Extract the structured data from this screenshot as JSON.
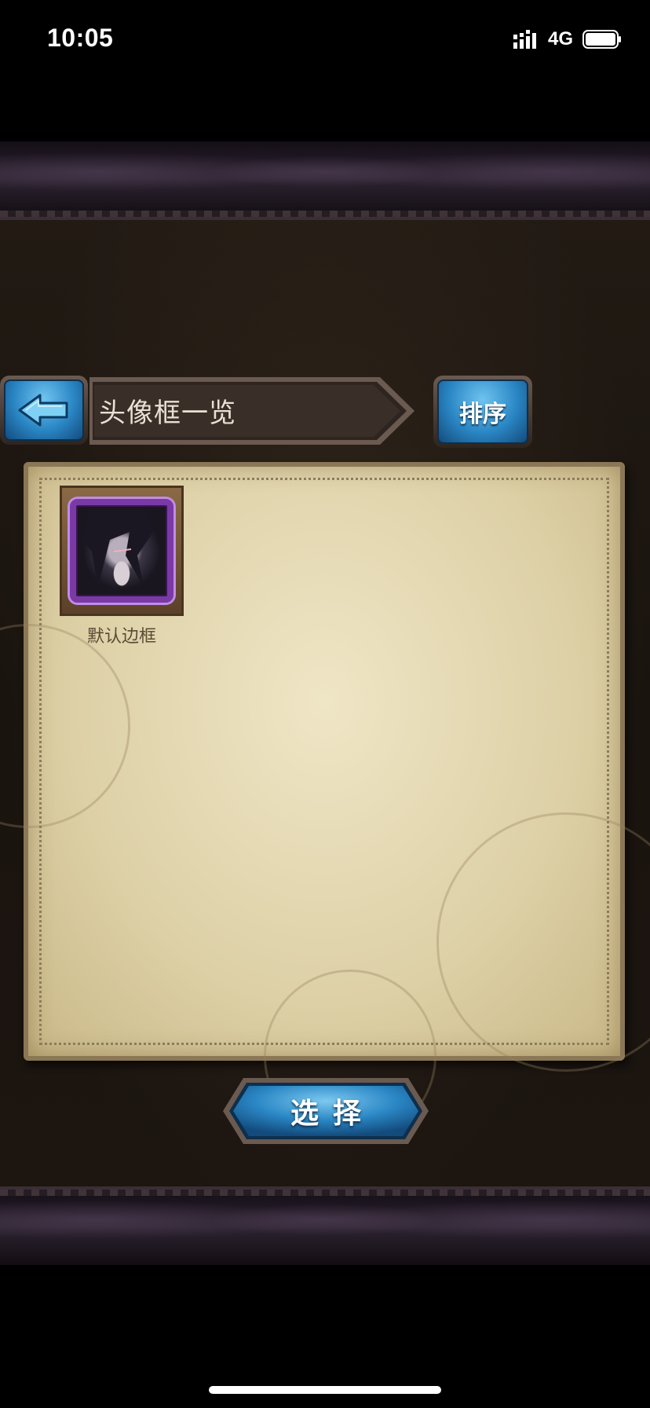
{
  "status_bar": {
    "time": "10:05",
    "network": "4G",
    "icons": [
      "signal-icon",
      "battery-icon"
    ]
  },
  "header": {
    "back_icon": "arrow-left-icon",
    "title": "头像框一览",
    "sort_label": "排序"
  },
  "frames": [
    {
      "label": "默认边框",
      "selected": true
    }
  ],
  "footer": {
    "select_label": "选择"
  },
  "colors": {
    "button_blue": "#2a86c4",
    "frame_purple": "#7a3aa6",
    "parchment": "#e6dcb8",
    "background": "#1c1510"
  }
}
